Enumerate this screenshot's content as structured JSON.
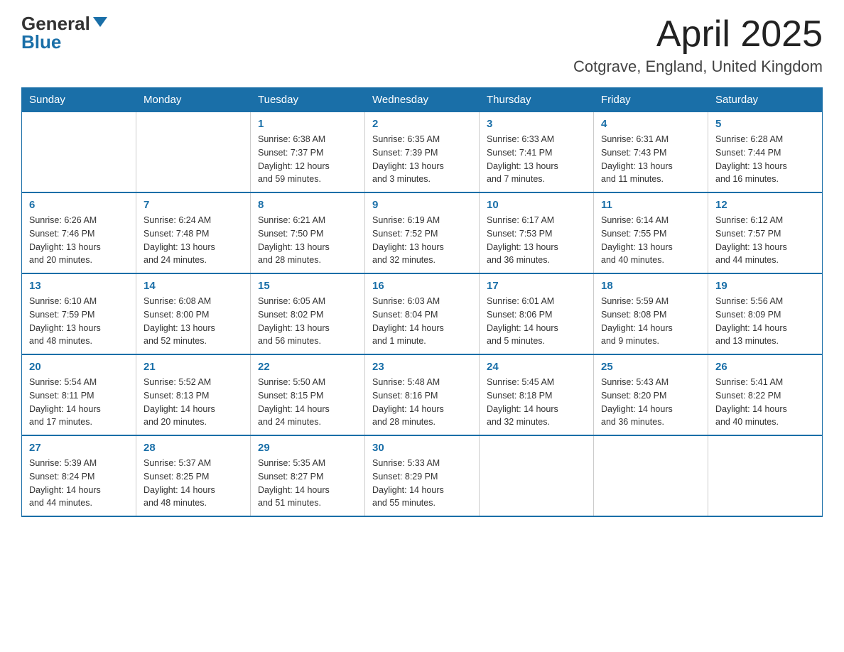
{
  "logo": {
    "general": "General",
    "blue": "Blue"
  },
  "title": "April 2025",
  "subtitle": "Cotgrave, England, United Kingdom",
  "days_of_week": [
    "Sunday",
    "Monday",
    "Tuesday",
    "Wednesday",
    "Thursday",
    "Friday",
    "Saturday"
  ],
  "weeks": [
    [
      {
        "day": "",
        "info": ""
      },
      {
        "day": "",
        "info": ""
      },
      {
        "day": "1",
        "info": "Sunrise: 6:38 AM\nSunset: 7:37 PM\nDaylight: 12 hours\nand 59 minutes."
      },
      {
        "day": "2",
        "info": "Sunrise: 6:35 AM\nSunset: 7:39 PM\nDaylight: 13 hours\nand 3 minutes."
      },
      {
        "day": "3",
        "info": "Sunrise: 6:33 AM\nSunset: 7:41 PM\nDaylight: 13 hours\nand 7 minutes."
      },
      {
        "day": "4",
        "info": "Sunrise: 6:31 AM\nSunset: 7:43 PM\nDaylight: 13 hours\nand 11 minutes."
      },
      {
        "day": "5",
        "info": "Sunrise: 6:28 AM\nSunset: 7:44 PM\nDaylight: 13 hours\nand 16 minutes."
      }
    ],
    [
      {
        "day": "6",
        "info": "Sunrise: 6:26 AM\nSunset: 7:46 PM\nDaylight: 13 hours\nand 20 minutes."
      },
      {
        "day": "7",
        "info": "Sunrise: 6:24 AM\nSunset: 7:48 PM\nDaylight: 13 hours\nand 24 minutes."
      },
      {
        "day": "8",
        "info": "Sunrise: 6:21 AM\nSunset: 7:50 PM\nDaylight: 13 hours\nand 28 minutes."
      },
      {
        "day": "9",
        "info": "Sunrise: 6:19 AM\nSunset: 7:52 PM\nDaylight: 13 hours\nand 32 minutes."
      },
      {
        "day": "10",
        "info": "Sunrise: 6:17 AM\nSunset: 7:53 PM\nDaylight: 13 hours\nand 36 minutes."
      },
      {
        "day": "11",
        "info": "Sunrise: 6:14 AM\nSunset: 7:55 PM\nDaylight: 13 hours\nand 40 minutes."
      },
      {
        "day": "12",
        "info": "Sunrise: 6:12 AM\nSunset: 7:57 PM\nDaylight: 13 hours\nand 44 minutes."
      }
    ],
    [
      {
        "day": "13",
        "info": "Sunrise: 6:10 AM\nSunset: 7:59 PM\nDaylight: 13 hours\nand 48 minutes."
      },
      {
        "day": "14",
        "info": "Sunrise: 6:08 AM\nSunset: 8:00 PM\nDaylight: 13 hours\nand 52 minutes."
      },
      {
        "day": "15",
        "info": "Sunrise: 6:05 AM\nSunset: 8:02 PM\nDaylight: 13 hours\nand 56 minutes."
      },
      {
        "day": "16",
        "info": "Sunrise: 6:03 AM\nSunset: 8:04 PM\nDaylight: 14 hours\nand 1 minute."
      },
      {
        "day": "17",
        "info": "Sunrise: 6:01 AM\nSunset: 8:06 PM\nDaylight: 14 hours\nand 5 minutes."
      },
      {
        "day": "18",
        "info": "Sunrise: 5:59 AM\nSunset: 8:08 PM\nDaylight: 14 hours\nand 9 minutes."
      },
      {
        "day": "19",
        "info": "Sunrise: 5:56 AM\nSunset: 8:09 PM\nDaylight: 14 hours\nand 13 minutes."
      }
    ],
    [
      {
        "day": "20",
        "info": "Sunrise: 5:54 AM\nSunset: 8:11 PM\nDaylight: 14 hours\nand 17 minutes."
      },
      {
        "day": "21",
        "info": "Sunrise: 5:52 AM\nSunset: 8:13 PM\nDaylight: 14 hours\nand 20 minutes."
      },
      {
        "day": "22",
        "info": "Sunrise: 5:50 AM\nSunset: 8:15 PM\nDaylight: 14 hours\nand 24 minutes."
      },
      {
        "day": "23",
        "info": "Sunrise: 5:48 AM\nSunset: 8:16 PM\nDaylight: 14 hours\nand 28 minutes."
      },
      {
        "day": "24",
        "info": "Sunrise: 5:45 AM\nSunset: 8:18 PM\nDaylight: 14 hours\nand 32 minutes."
      },
      {
        "day": "25",
        "info": "Sunrise: 5:43 AM\nSunset: 8:20 PM\nDaylight: 14 hours\nand 36 minutes."
      },
      {
        "day": "26",
        "info": "Sunrise: 5:41 AM\nSunset: 8:22 PM\nDaylight: 14 hours\nand 40 minutes."
      }
    ],
    [
      {
        "day": "27",
        "info": "Sunrise: 5:39 AM\nSunset: 8:24 PM\nDaylight: 14 hours\nand 44 minutes."
      },
      {
        "day": "28",
        "info": "Sunrise: 5:37 AM\nSunset: 8:25 PM\nDaylight: 14 hours\nand 48 minutes."
      },
      {
        "day": "29",
        "info": "Sunrise: 5:35 AM\nSunset: 8:27 PM\nDaylight: 14 hours\nand 51 minutes."
      },
      {
        "day": "30",
        "info": "Sunrise: 5:33 AM\nSunset: 8:29 PM\nDaylight: 14 hours\nand 55 minutes."
      },
      {
        "day": "",
        "info": ""
      },
      {
        "day": "",
        "info": ""
      },
      {
        "day": "",
        "info": ""
      }
    ]
  ]
}
